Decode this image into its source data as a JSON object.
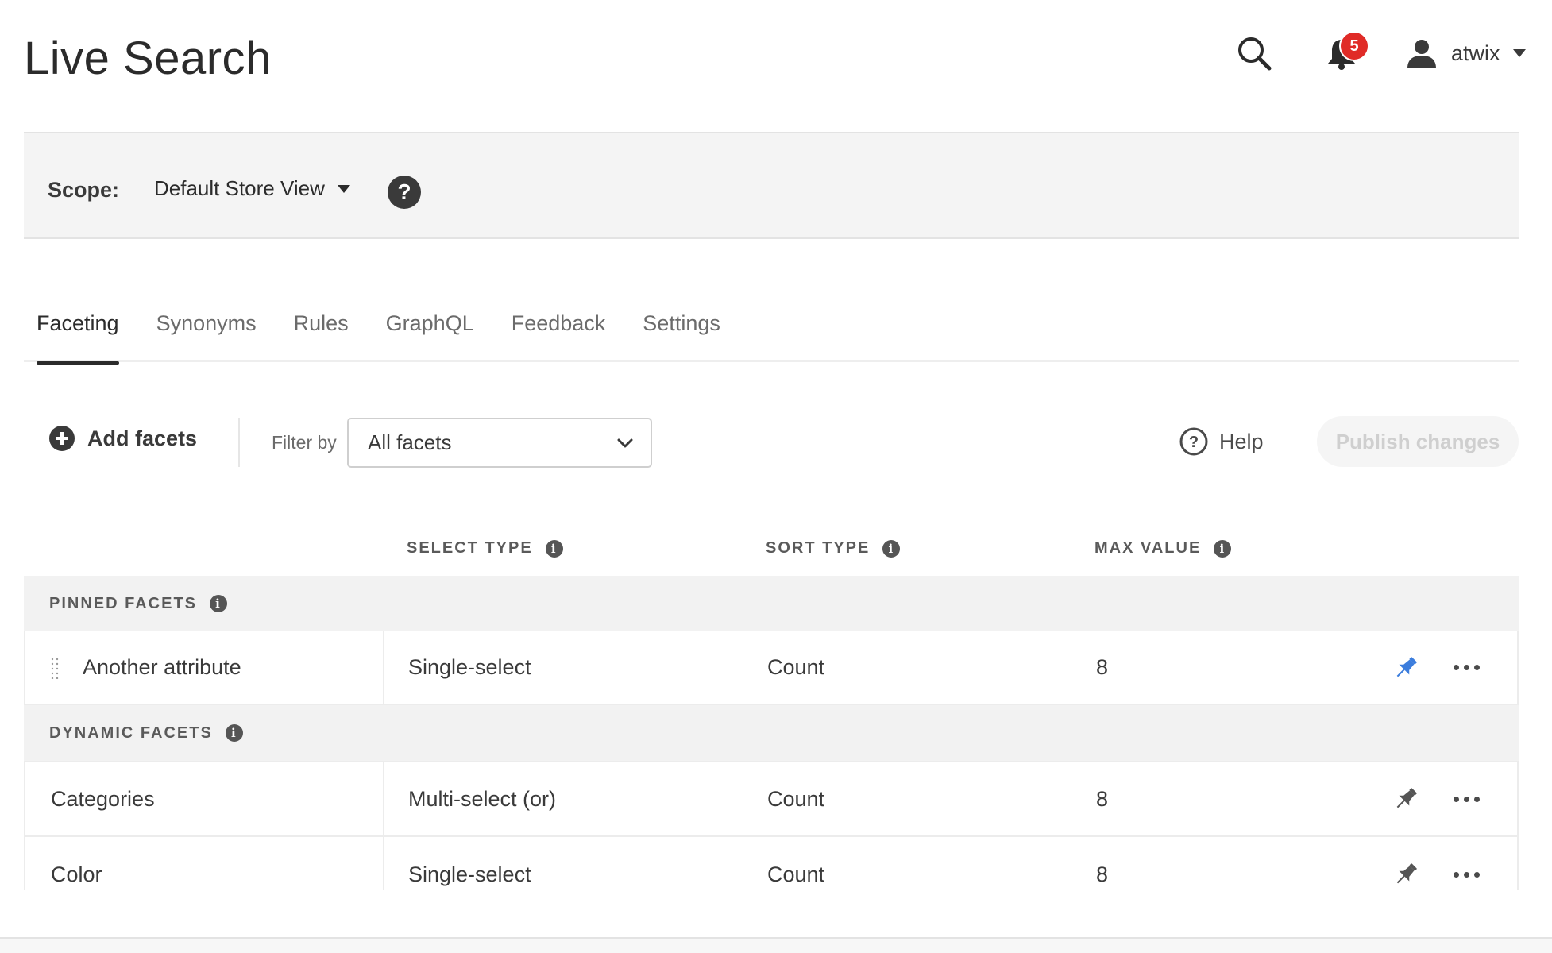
{
  "page": {
    "title": "Live Search"
  },
  "header": {
    "notifications_count": "5",
    "user_name": "atwix"
  },
  "scope": {
    "label": "Scope:",
    "value": "Default Store View"
  },
  "tabs": [
    {
      "label": "Faceting",
      "active": true
    },
    {
      "label": "Synonyms",
      "active": false
    },
    {
      "label": "Rules",
      "active": false
    },
    {
      "label": "GraphQL",
      "active": false
    },
    {
      "label": "Feedback",
      "active": false
    },
    {
      "label": "Settings",
      "active": false
    }
  ],
  "toolbar": {
    "add_facets_label": "Add facets",
    "filter_label": "Filter by",
    "filter_value": "All facets",
    "help_label": "Help",
    "publish_label": "Publish changes"
  },
  "table": {
    "columns": {
      "select_type": "SELECT TYPE",
      "sort_type": "SORT TYPE",
      "max_value": "MAX VALUE"
    },
    "sections": {
      "pinned": "PINNED FACETS",
      "dynamic": "DYNAMIC FACETS"
    },
    "pinned_rows": [
      {
        "name": "Another attribute",
        "select_type": "Single-select",
        "sort_type": "Count",
        "max_value": "8",
        "pinned": true
      }
    ],
    "dynamic_rows": [
      {
        "name": "Categories",
        "select_type": "Multi-select (or)",
        "sort_type": "Count",
        "max_value": "8",
        "pinned": false
      },
      {
        "name": "Color",
        "select_type": "Single-select",
        "sort_type": "Count",
        "max_value": "8",
        "pinned": false
      }
    ]
  },
  "colors": {
    "pin_active": "#3b7ddd",
    "pin_inactive": "#555555",
    "badge": "#e02b27",
    "section_bg": "#f2f2f2"
  }
}
